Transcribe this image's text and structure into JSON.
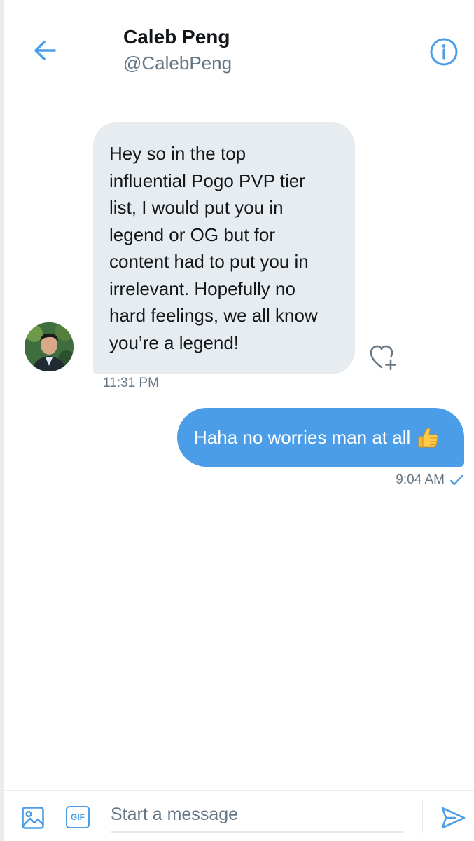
{
  "header": {
    "name": "Caleb Peng",
    "handle": "@CalebPeng"
  },
  "messages": [
    {
      "direction": "incoming",
      "lines": [
        "Hey so in the top",
        "influential Pogo PVP tier",
        "list, I would put you in",
        "legend or OG but for",
        "content had to put you in",
        "irrelevant. Hopefully no",
        "hard feelings, we all know",
        "you’re a legend!"
      ],
      "time": "11:31 PM"
    },
    {
      "direction": "outgoing",
      "text": "Haha no worries man at all",
      "emoji": "thumbs-up",
      "time": "9:04 AM",
      "status": "read-check"
    }
  ],
  "composer": {
    "placeholder": "Start a message",
    "gif_label": "GIF"
  },
  "colors": {
    "accent": "#4a9de6",
    "incoming_bubble": "#e6ecf0",
    "secondary_text": "#657786"
  }
}
